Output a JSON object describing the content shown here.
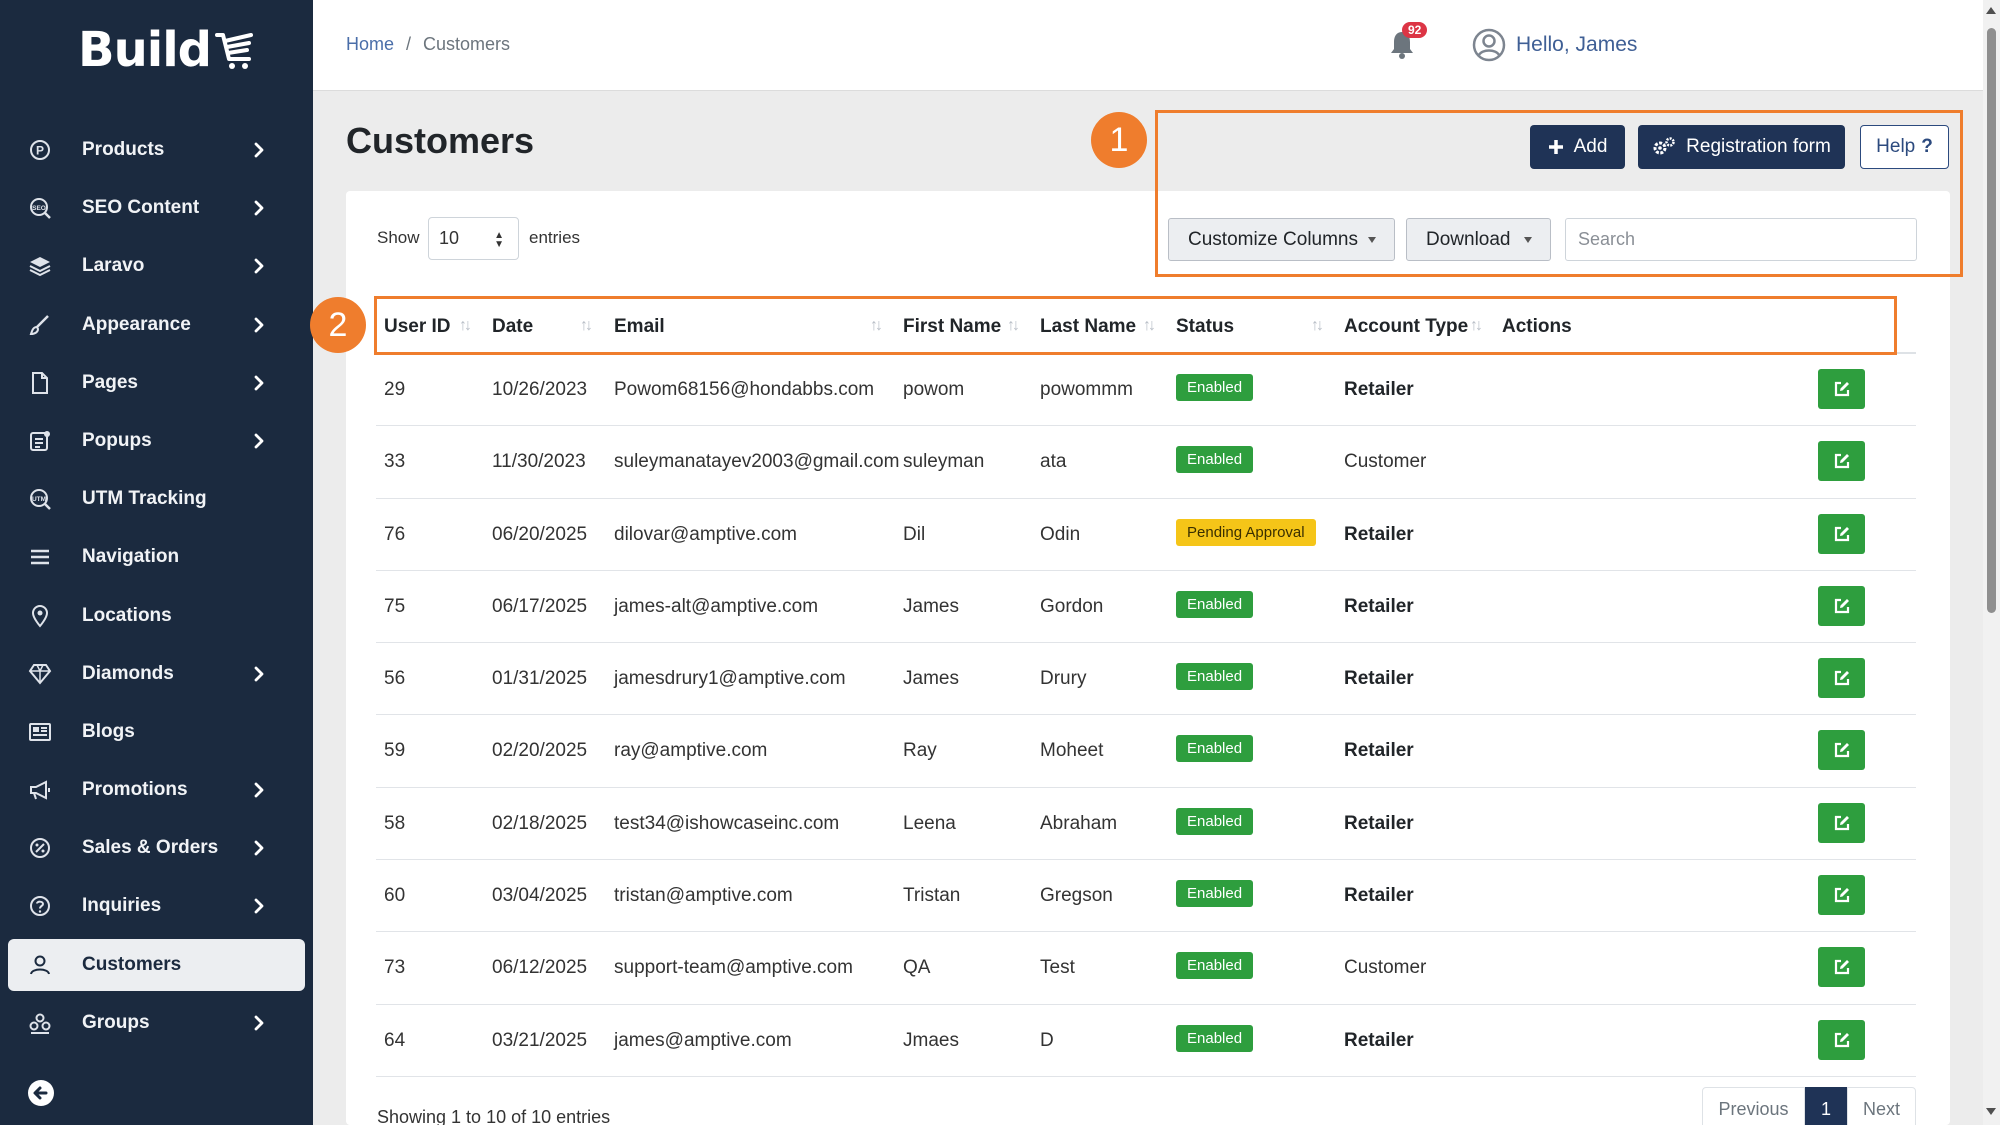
{
  "app": {
    "logo_text": "Build"
  },
  "sidebar": {
    "items": [
      {
        "label": "Products",
        "icon": "products-icon",
        "has_submenu": true
      },
      {
        "label": "SEO Content",
        "icon": "seo-icon",
        "has_submenu": true
      },
      {
        "label": "Laravo",
        "icon": "layers-icon",
        "has_submenu": true
      },
      {
        "label": "Appearance",
        "icon": "brush-icon",
        "has_submenu": true
      },
      {
        "label": "Pages",
        "icon": "page-icon",
        "has_submenu": true
      },
      {
        "label": "Popups",
        "icon": "popup-icon",
        "has_submenu": true
      },
      {
        "label": "UTM Tracking",
        "icon": "utm-icon",
        "has_submenu": false
      },
      {
        "label": "Navigation",
        "icon": "menu-icon",
        "has_submenu": false
      },
      {
        "label": "Locations",
        "icon": "location-pin-icon",
        "has_submenu": false
      },
      {
        "label": "Diamonds",
        "icon": "diamond-icon",
        "has_submenu": true
      },
      {
        "label": "Blogs",
        "icon": "blog-icon",
        "has_submenu": false
      },
      {
        "label": "Promotions",
        "icon": "megaphone-icon",
        "has_submenu": true
      },
      {
        "label": "Sales & Orders",
        "icon": "sales-icon",
        "has_submenu": true
      },
      {
        "label": "Inquiries",
        "icon": "question-icon",
        "has_submenu": true
      },
      {
        "label": "Customers",
        "icon": "user-icon",
        "has_submenu": false,
        "active": true
      },
      {
        "label": "Groups",
        "icon": "groups-icon",
        "has_submenu": true
      }
    ]
  },
  "breadcrumb": {
    "home": "Home",
    "separator": "/",
    "current": "Customers"
  },
  "header": {
    "notification_count": "92",
    "greeting": "Hello, James"
  },
  "page": {
    "title": "Customers",
    "add_label": "Add",
    "registration_label": "Registration form",
    "help_label": "Help"
  },
  "controls": {
    "show_label": "Show",
    "entries_value": "10",
    "entries_label": "entries",
    "customize_label": "Customize Columns",
    "download_label": "Download",
    "search_placeholder": "Search"
  },
  "table": {
    "columns": [
      "User ID",
      "Date",
      "Email",
      "First Name",
      "Last Name",
      "Status",
      "Account Type",
      "Actions"
    ],
    "rows": [
      {
        "id": "29",
        "date": "10/26/2023",
        "email": "Powom68156@hondabbs.com",
        "first": "powom",
        "last": "powommm",
        "status": "Enabled",
        "type": "Retailer"
      },
      {
        "id": "33",
        "date": "11/30/2023",
        "email": "suleymanatayev2003@gmail.com",
        "first": "suleyman",
        "last": "ata",
        "status": "Enabled",
        "type": "Customer"
      },
      {
        "id": "76",
        "date": "06/20/2025",
        "email": "dilovar@amptive.com",
        "first": "Dil",
        "last": "Odin",
        "status": "Pending Approval",
        "type": "Retailer"
      },
      {
        "id": "75",
        "date": "06/17/2025",
        "email": "james-alt@amptive.com",
        "first": "James",
        "last": "Gordon",
        "status": "Enabled",
        "type": "Retailer"
      },
      {
        "id": "56",
        "date": "01/31/2025",
        "email": "jamesdrury1@amptive.com",
        "first": "James",
        "last": "Drury",
        "status": "Enabled",
        "type": "Retailer"
      },
      {
        "id": "59",
        "date": "02/20/2025",
        "email": "ray@amptive.com",
        "first": "Ray",
        "last": "Moheet",
        "status": "Enabled",
        "type": "Retailer"
      },
      {
        "id": "58",
        "date": "02/18/2025",
        "email": "test34@ishowcaseinc.com",
        "first": "Leena",
        "last": "Abraham",
        "status": "Enabled",
        "type": "Retailer"
      },
      {
        "id": "60",
        "date": "03/04/2025",
        "email": "tristan@amptive.com",
        "first": "Tristan",
        "last": "Gregson",
        "status": "Enabled",
        "type": "Retailer"
      },
      {
        "id": "73",
        "date": "06/12/2025",
        "email": "support-team@amptive.com",
        "first": "QA",
        "last": "Test",
        "status": "Enabled",
        "type": "Customer"
      },
      {
        "id": "64",
        "date": "03/21/2025",
        "email": "james@amptive.com",
        "first": "Jmaes",
        "last": "D",
        "status": "Enabled",
        "type": "Retailer"
      }
    ]
  },
  "footer": {
    "info": "Showing 1 to 10 of 10 entries",
    "previous": "Previous",
    "page": "1",
    "next": "Next"
  },
  "annotations": {
    "marker1": "1",
    "marker2": "2"
  },
  "colors": {
    "sidebar_bg": "#1b2a3f",
    "primary_button": "#1f3356",
    "enabled_badge": "#2e9e3e",
    "pending_badge": "#f5c518",
    "annotation": "#ef7d2d"
  }
}
